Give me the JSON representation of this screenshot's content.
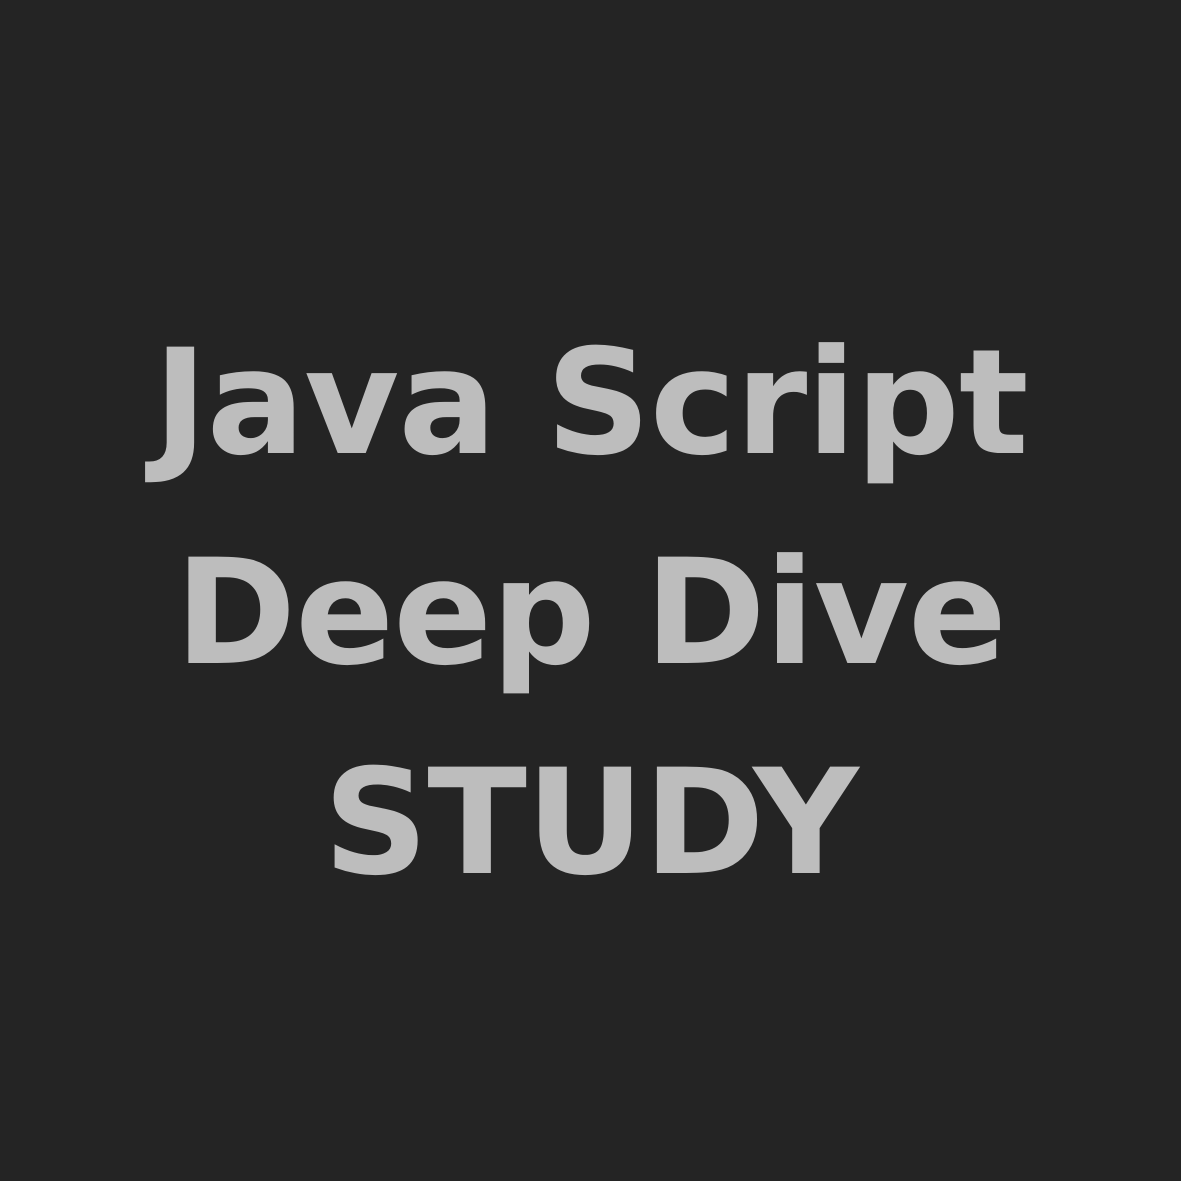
{
  "background_color": "#242424",
  "text_color": "#BDBDBD",
  "title_lines": [
    "Java Script",
    "Deep Dive",
    "STUDY"
  ]
}
